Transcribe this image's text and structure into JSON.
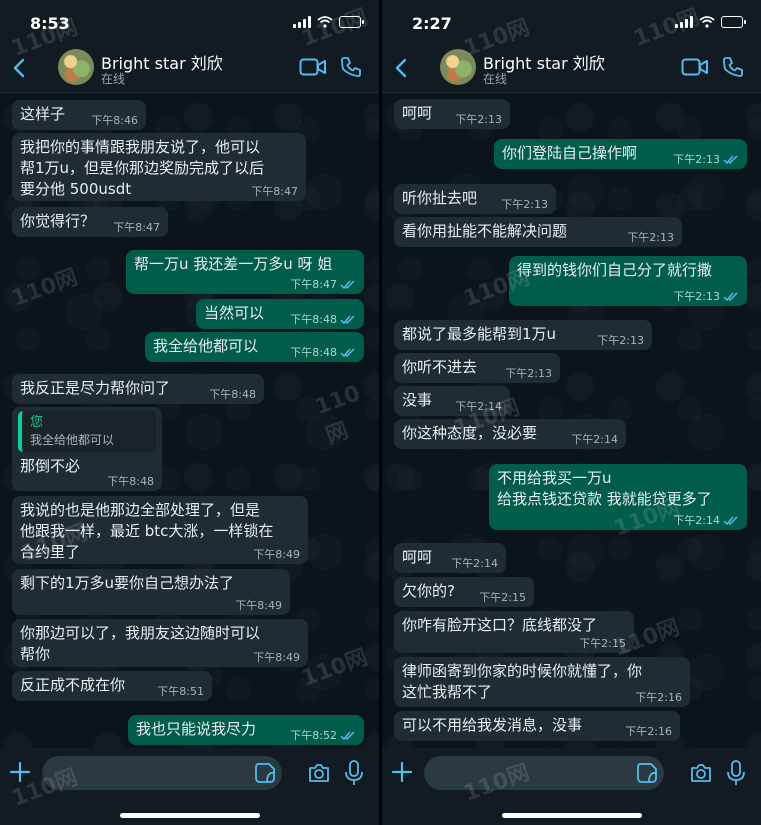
{
  "left": {
    "status_time": "8:53",
    "contact_name": "Bright star 刘欣",
    "contact_status": "在线",
    "messages": [
      {
        "text": "这样子",
        "time": "下午8:46"
      },
      {
        "text": "我把你的事情跟我朋友说了，他可以\n帮1万u，但是你那边奖励完成了以后\n要分他 500usdt",
        "time": "下午8:47"
      },
      {
        "text": "你觉得行？",
        "time": "下午8:47"
      },
      {
        "text": "帮一万u 我还差一万多u 呀 姐",
        "time": "下午8:47"
      },
      {
        "text": "当然可以",
        "time": "下午8:48"
      },
      {
        "text": "我全给他都可以",
        "time": "下午8:48"
      },
      {
        "text": "我反正是尽力帮你问了",
        "time": "下午8:48"
      },
      {
        "text": "那倒不必",
        "time": "下午8:48",
        "quote_author": "您",
        "quote_text": "我全给他都可以"
      },
      {
        "text": "我说的也是他那边全部处理了，但是\n他跟我一样，最近 btc大涨，一样锁在\n合约里了",
        "time": "下午8:49"
      },
      {
        "text": "剩下的1万多u要你自己想办法了",
        "time": "下午8:49"
      },
      {
        "text": "你那边可以了，我朋友这边随时可以\n帮你",
        "time": "下午8:49"
      },
      {
        "text": "反正成不成在你",
        "time": "下午8:51"
      },
      {
        "text": "我也只能说我尽力",
        "time": "下午8:52"
      }
    ]
  },
  "right": {
    "status_time": "2:27",
    "contact_name": "Bright star 刘欣",
    "contact_status": "在线",
    "messages": [
      {
        "text": "呵呵",
        "time": "下午2:13"
      },
      {
        "text": "你们登陆自己操作啊",
        "time": "下午2:13"
      },
      {
        "text": "听你扯去吧",
        "time": "下午2:13"
      },
      {
        "text": "看你用扯能不能解决问题",
        "time": "下午2:13"
      },
      {
        "text": "得到的钱你们自己分了就行撒",
        "time": "下午2:13"
      },
      {
        "text": "都说了最多能帮到1万u",
        "time": "下午2:13"
      },
      {
        "text": "你听不进去",
        "time": "下午2:13"
      },
      {
        "text": "没事",
        "time": "下午2:14"
      },
      {
        "text": "你这种态度，没必要",
        "time": "下午2:14"
      },
      {
        "text": "不用给我买一万u\n给我点钱还贷款 我就能贷更多了",
        "time": "下午2:14"
      },
      {
        "text": "呵呵",
        "time": "下午2:14"
      },
      {
        "text": "欠你的?",
        "time": "下午2:15"
      },
      {
        "text": "你咋有脸开这口？底线都没了",
        "time": "下午2:15"
      },
      {
        "text": "律师函寄到你家的时候你就懂了，你\n这忙我帮不了",
        "time": "下午2:16"
      },
      {
        "text": "可以不用给我发消息，没事",
        "time": "下午2:16"
      }
    ]
  },
  "watermark_text": "110网",
  "colors": {
    "incoming": "#202c33",
    "outgoing": "#005c4b",
    "accent": "#53bdeb",
    "background": "#0b141a"
  },
  "icons": [
    "back-arrow-icon",
    "video-call-icon",
    "phone-icon",
    "plus-icon",
    "sticker-icon",
    "camera-icon",
    "microphone-icon",
    "read-ticks-icon"
  ]
}
